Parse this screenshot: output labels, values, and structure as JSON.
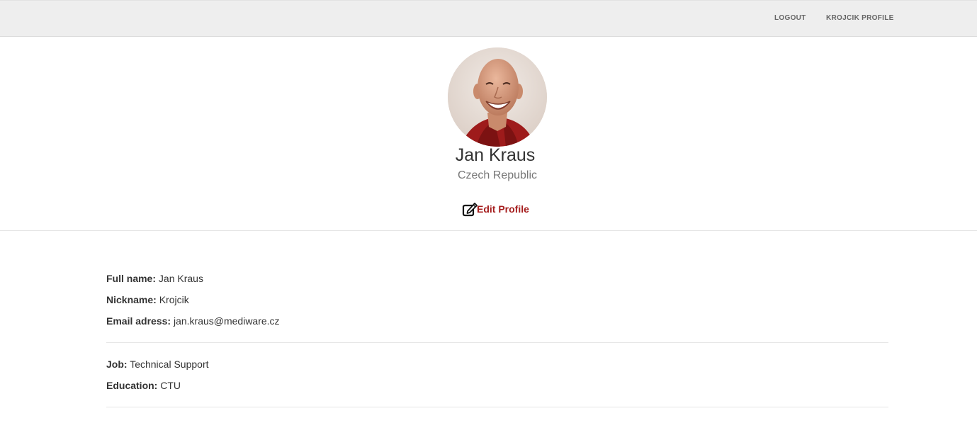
{
  "nav": {
    "logout_label": "LOGOUT",
    "profile_label": "KROJCIK PROFILE"
  },
  "profile": {
    "name": "Jan Kraus",
    "country": "Czech Republic",
    "edit_label": "Edit Profile",
    "avatar_icon": "user-photo",
    "edit_icon": "edit-icon"
  },
  "details": {
    "full_name_label": "Full name:",
    "full_name": "Jan Kraus",
    "nickname_label": "Nickname:",
    "nickname": "Krojcik",
    "email_label": "Email adress:",
    "email": "jan.kraus@mediware.cz",
    "job_label": "Job:",
    "job": "Technical Support",
    "education_label": "Education:",
    "education": "CTU"
  },
  "colors": {
    "navbar_bg": "#eeeeee",
    "accent": "#a51d1d",
    "text": "#333333",
    "muted": "#777777"
  }
}
